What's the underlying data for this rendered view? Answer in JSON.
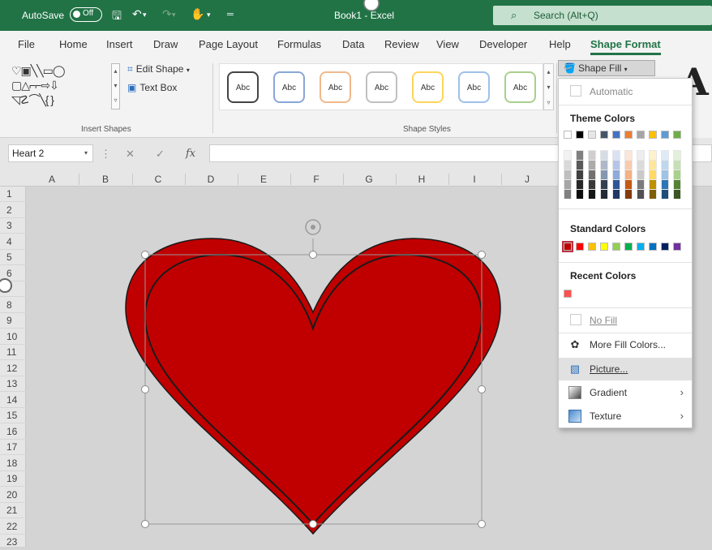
{
  "titlebar": {
    "autosave_label": "AutoSave",
    "autosave_state": "Off",
    "doc_title": "Book1 - Excel",
    "search_placeholder": "Search (Alt+Q)"
  },
  "tabs": [
    "File",
    "Home",
    "Insert",
    "Draw",
    "Page Layout",
    "Formulas",
    "Data",
    "Review",
    "View",
    "Developer",
    "Help",
    "Shape Format"
  ],
  "active_tab": "Shape Format",
  "ribbon": {
    "edit_shape": "Edit Shape",
    "text_box": "Text Box",
    "insert_shapes_label": "Insert Shapes",
    "style_label": "Abc",
    "shape_styles_label": "Shape Styles",
    "shape_fill": "Shape Fill",
    "style_border_colors": [
      "#444444",
      "#8aa6d8",
      "#f0b98c",
      "#c0c0c0",
      "#ffd55a",
      "#9fc0e8",
      "#a8d08d"
    ]
  },
  "formula_bar": {
    "name_box": "Heart 2",
    "fx": "fx"
  },
  "columns": [
    "A",
    "B",
    "C",
    "D",
    "E",
    "F",
    "G",
    "H",
    "I",
    "J"
  ],
  "rows": [
    "1",
    "2",
    "3",
    "4",
    "5",
    "6",
    "7",
    "8",
    "9",
    "10",
    "11",
    "12",
    "13",
    "14",
    "15",
    "16",
    "17",
    "18",
    "19",
    "20",
    "21",
    "22",
    "23"
  ],
  "shape": {
    "name": "Heart 2",
    "fill_color": "#c00000",
    "outline_color": "#1a1a1a"
  },
  "fill_menu": {
    "automatic": "Automatic",
    "theme_colors_header": "Theme Colors",
    "theme_colors": [
      "#ffffff",
      "#000000",
      "#e7e6e6",
      "#44546a",
      "#4472c4",
      "#ed7d31",
      "#a5a5a5",
      "#ffc000",
      "#5b9bd5",
      "#70ad47"
    ],
    "theme_shades": [
      [
        "#f2f2f2",
        "#d9d9d9",
        "#bfbfbf",
        "#a6a6a6",
        "#808080"
      ],
      [
        "#808080",
        "#595959",
        "#404040",
        "#262626",
        "#0d0d0d"
      ],
      [
        "#d0cece",
        "#aeaaaa",
        "#757171",
        "#3a3838",
        "#171616"
      ],
      [
        "#d6dce4",
        "#adb9ca",
        "#8497b0",
        "#333f4f",
        "#222a35"
      ],
      [
        "#d9e1f2",
        "#b4c6e7",
        "#8ea9db",
        "#2f5597",
        "#1f3864"
      ],
      [
        "#fbe5d6",
        "#f8cbad",
        "#f4b183",
        "#c55a11",
        "#843c0c"
      ],
      [
        "#ededed",
        "#dbdbdb",
        "#c9c9c9",
        "#7b7b7b",
        "#525252"
      ],
      [
        "#fff2cc",
        "#ffe699",
        "#ffd966",
        "#bf8f00",
        "#7f6000"
      ],
      [
        "#deebf7",
        "#bdd7ee",
        "#9dc3e6",
        "#2e75b6",
        "#1f4e79"
      ],
      [
        "#e2f0d9",
        "#c5e0b4",
        "#a9d18e",
        "#548235",
        "#385723"
      ]
    ],
    "standard_colors_header": "Standard Colors",
    "standard_colors": [
      "#c00000",
      "#ff0000",
      "#ffc000",
      "#ffff00",
      "#92d050",
      "#00b050",
      "#00b0f0",
      "#0070c0",
      "#002060",
      "#7030a0"
    ],
    "recent_colors_header": "Recent Colors",
    "recent_colors": [
      "#ff5050"
    ],
    "no_fill": "No Fill",
    "more_fill_colors": "More Fill Colors...",
    "picture": "Picture...",
    "gradient": "Gradient",
    "texture": "Texture"
  }
}
